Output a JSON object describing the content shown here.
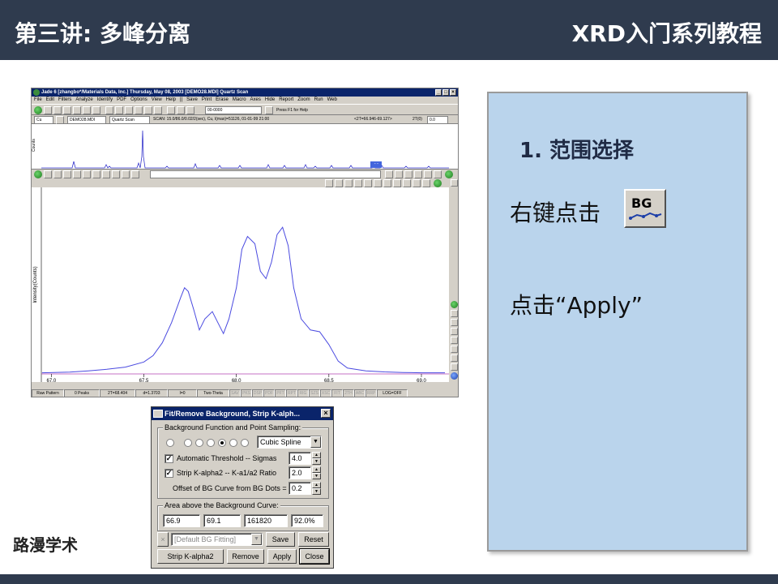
{
  "header": {
    "title_left": "第三讲: 多峰分离",
    "title_right": "XRD入门系列教程"
  },
  "brand": "路漫学术",
  "jade": {
    "title": "Jade 6 [zhangbo*/Materials Data, Inc.] Thursday, May 08, 2003 [DEMO28.MDI] Quartz Scan",
    "menu": [
      "File",
      "Edit",
      "Filters",
      "Analyze",
      "Identify",
      "PDF",
      "Options",
      "View",
      "Help",
      "||",
      "Save",
      "Print",
      "Erase",
      "Macro",
      "Axes",
      "Hide",
      "Report",
      "Zoom",
      "Run",
      "Web"
    ],
    "toolbar_select": "00-0000",
    "help_hint": "Press F1 for Help",
    "row2": {
      "element": "Cu",
      "file": "DEMO28.MDI",
      "sample": "Quartz Scan",
      "scan_info": "SCAN: 15.0/86.0/0.02/2(sec), Cu, I(max)=51126, 01-01-99 21:00",
      "range": "<2T=66.946-69.127>",
      "twotheta_label": "2T(0)",
      "twotheta_value": "0.0"
    },
    "overview_ylabel": "Counts",
    "main_ylabel": "Intensity(Counts)",
    "xticks": [
      "67.0",
      "67.5",
      "68.0",
      "68.5",
      "69.0"
    ],
    "status": [
      {
        "text": "Raw Pattern",
        "dim": false
      },
      {
        "text": "0 Peaks",
        "dim": false
      },
      {
        "text": "2T=68.404",
        "dim": false
      },
      {
        "text": "d=1.3703",
        "dim": false
      },
      {
        "text": "I=0",
        "dim": false
      },
      {
        "text": "Two-Theta",
        "dim": false
      },
      {
        "text": "SAV",
        "dim": true
      },
      {
        "text": "PKS",
        "dim": true
      },
      {
        "text": "DSP",
        "dim": true
      },
      {
        "text": "PDF",
        "dim": true
      },
      {
        "text": "PFT",
        "dim": true
      },
      {
        "text": "RPT",
        "dim": true
      },
      {
        "text": "RIG",
        "dim": true
      },
      {
        "text": "SZS",
        "dim": true
      },
      {
        "text": "XSC",
        "dim": true
      },
      {
        "text": "FIT",
        "dim": true
      },
      {
        "text": "2TH",
        "dim": true
      },
      {
        "text": "ABC",
        "dim": true
      },
      {
        "text": "RRP",
        "dim": true
      },
      {
        "text": "LOG=OFF",
        "dim": false
      }
    ]
  },
  "chart_data": {
    "type": "line",
    "xlim": [
      66.946,
      69.127
    ],
    "ylim": [
      0,
      100
    ],
    "grid": false,
    "series": [
      {
        "x": [
          66.95,
          67.1,
          67.2,
          67.3,
          67.4,
          67.5,
          67.55,
          67.6,
          67.65,
          67.7,
          67.72,
          67.74,
          67.77,
          67.8,
          67.83,
          67.87,
          67.9,
          67.93,
          67.96,
          68.0,
          68.03,
          68.06,
          68.1,
          68.13,
          68.16,
          68.19,
          68.22,
          68.25,
          68.28,
          68.31,
          68.35,
          68.4,
          68.45,
          68.5,
          68.55,
          68.6,
          68.7,
          68.8,
          68.9,
          69.0,
          69.127
        ],
        "y": [
          0.6,
          1.0,
          1.7,
          2.5,
          3.7,
          6.5,
          10,
          17,
          28,
          42,
          47,
          45,
          35,
          24,
          30,
          34,
          28,
          22,
          30,
          47,
          68,
          75,
          71,
          56,
          52,
          61,
          76,
          80,
          70,
          47,
          30,
          24,
          23,
          16,
          7,
          3.2,
          1.7,
          1.1,
          0.8,
          0.6,
          0.6
        ]
      }
    ]
  },
  "dialog": {
    "title": "Fit/Remove Background, Strip K-alph...",
    "group1_label": "Background Function and Point Sampling:",
    "function": "Cubic Spline",
    "auto_threshold_label": "Automatic Threshold -- Sigmas",
    "auto_threshold_value": "4.0",
    "strip_label": "Strip K-alpha2 -- K-a1/a2 Ratio",
    "strip_value": "2.0",
    "offset_label": "Offset of BG Curve from BG Dots =",
    "offset_value": "0.2",
    "group2_label": "Area above the Background Curve:",
    "area_values": [
      "66.9",
      "69.1",
      "161820",
      "92.0%"
    ],
    "preset": "[Default BG Fitting]",
    "save": "Save",
    "reset": "Reset",
    "strip_button": "Strip K-alpha2",
    "remove": "Remove",
    "apply": "Apply",
    "close": "Close"
  },
  "panel": {
    "step_title": "1. 范围选择",
    "line1": "右键点击",
    "bg_icon_label": "BG",
    "line2": "点击“Apply”"
  }
}
